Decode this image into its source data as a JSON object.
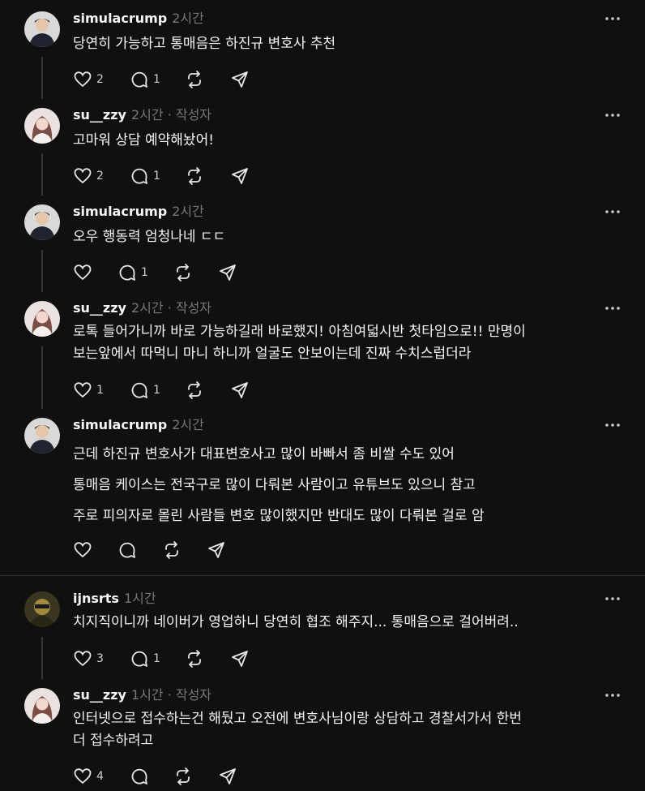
{
  "posts": [
    {
      "user": "simulacrump",
      "time": "2시간",
      "author": "",
      "lines": [
        "당연히 가능하고 통매음은 하진규 변호사 추천"
      ],
      "likes": "2",
      "replies": "1"
    },
    {
      "user": "su__zzy",
      "time": "2시간",
      "author": "· 작성자",
      "lines": [
        "고마워 상담 예약해놨어!"
      ],
      "likes": "2",
      "replies": "1"
    },
    {
      "user": "simulacrump",
      "time": "2시간",
      "author": "",
      "lines": [
        "오우 행동력 엄청나네 ㄷㄷ"
      ],
      "likes": "",
      "replies": "1"
    },
    {
      "user": "su__zzy",
      "time": "2시간",
      "author": "· 작성자",
      "lines": [
        "로톡 들어가니까 바로 가능하길래 바로했지! 아침여덟시반 첫타임으로!! 만명이",
        "보는앞에서 따먹니 마니 하니까 얼굴도 안보이는데 진짜 수치스럽더라"
      ],
      "likes": "1",
      "replies": "1"
    },
    {
      "user": "simulacrump",
      "time": "2시간",
      "author": "",
      "lines": [
        "근데 하진규 변호사가 대표변호사고 많이 바빠서 좀 비쌀 수도 있어",
        "통매음 케이스는 전국구로 많이 다뤄본 사람이고 유튜브도 있으니 참고",
        "주로 피의자로 몰린 사람들 변호 많이했지만 반대도 많이 다뤄본 걸로 암"
      ],
      "likes": "",
      "replies": ""
    },
    {
      "user": "ijnsrts",
      "time": "1시간",
      "author": "",
      "lines": [
        "치지직이니까 네이버가 영업하니 당연히 협조 해주지... 통매음으로 걸어버려.."
      ],
      "likes": "3",
      "replies": "1"
    },
    {
      "user": "su__zzy",
      "time": "1시간",
      "author": "· 작성자",
      "lines": [
        "인터넷으로 접수하는건 해뒀고 오전에 변호사님이랑 상담하고 경찰서가서 한번",
        "더 접수하려고"
      ],
      "likes": "4",
      "replies": ""
    }
  ],
  "icons": {
    "like": "heart-icon",
    "reply": "comment-icon",
    "repost": "repost-icon",
    "share": "send-icon",
    "more": "more-icon"
  }
}
